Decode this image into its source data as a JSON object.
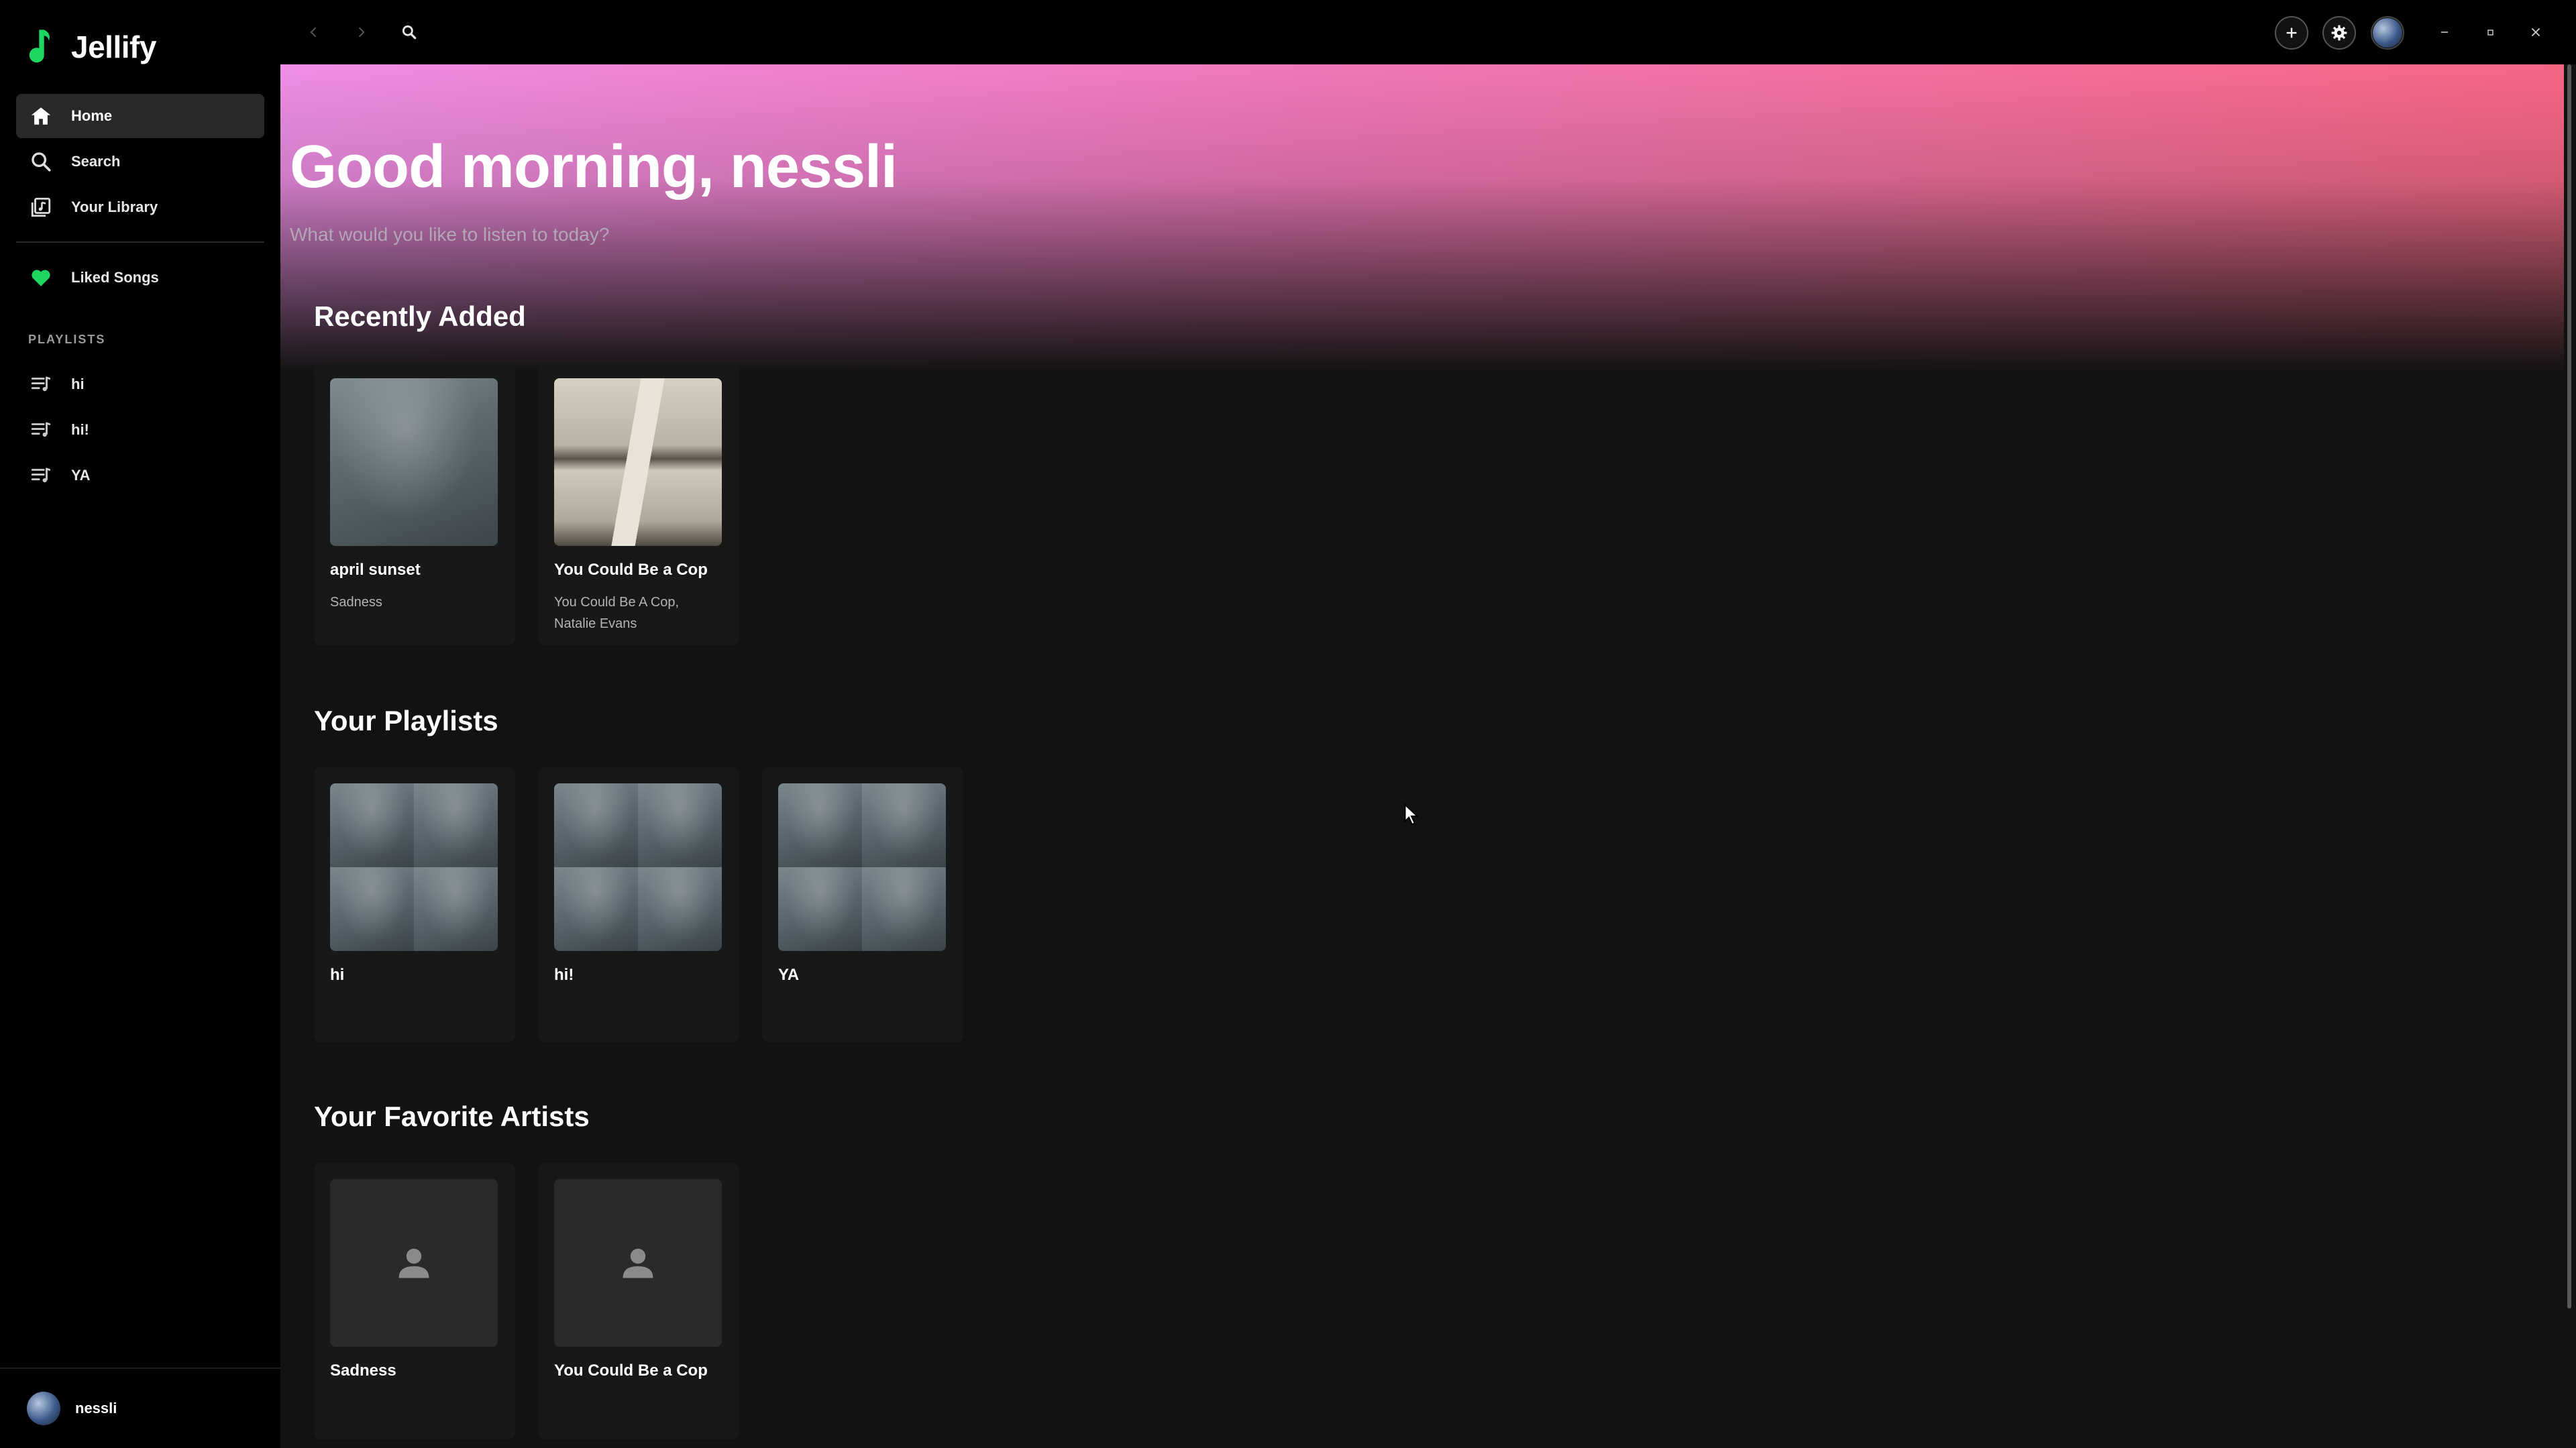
{
  "app": {
    "name": "Jellify"
  },
  "sidebar": {
    "nav": [
      {
        "label": "Home",
        "icon": "home-icon",
        "active": true
      },
      {
        "label": "Search",
        "icon": "search-icon",
        "active": false
      },
      {
        "label": "Your Library",
        "icon": "library-icon",
        "active": false
      }
    ],
    "liked": {
      "label": "Liked Songs",
      "icon": "heart-icon",
      "color": "#1ed760"
    },
    "playlists_header": "PLAYLISTS",
    "playlists": [
      {
        "label": "hi",
        "icon": "playlist-icon"
      },
      {
        "label": "hi!",
        "icon": "playlist-icon"
      },
      {
        "label": "YA",
        "icon": "playlist-icon"
      }
    ],
    "user": {
      "name": "nessli"
    }
  },
  "topbar": {
    "icons": [
      "back-icon",
      "forward-icon",
      "search-icon",
      "add-icon",
      "settings-icon",
      "avatar",
      "minimize-icon",
      "maximize-icon",
      "close-icon"
    ]
  },
  "main": {
    "greeting": "Good morning, nessli",
    "subtitle": "What would you like to listen to today?",
    "sections": {
      "recently_added": {
        "title": "Recently Added",
        "items": [
          {
            "title": "april sunset",
            "subtitle": "Sadness"
          },
          {
            "title": "You Could Be a Cop",
            "subtitle": "You Could Be A Cop, Natalie Evans"
          }
        ]
      },
      "playlists": {
        "title": "Your Playlists",
        "items": [
          {
            "title": "hi"
          },
          {
            "title": "hi!"
          },
          {
            "title": "YA"
          }
        ]
      },
      "artists": {
        "title": "Your Favorite Artists",
        "items": [
          {
            "title": "Sadness"
          },
          {
            "title": "You Could Be a Cop"
          }
        ]
      }
    }
  },
  "colors": {
    "accent": "#1ed760",
    "gradient_start": "#f08ee6",
    "gradient_end": "#f76784",
    "background": "#121212",
    "sidebar": "#000000"
  }
}
